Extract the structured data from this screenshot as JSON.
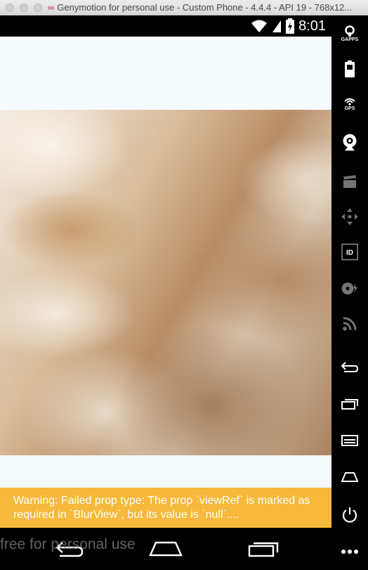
{
  "window": {
    "title": "Genymotion for personal use - Custom Phone - 4.4.4 - API 19 - 768x12..."
  },
  "statusbar": {
    "time": "8:01"
  },
  "app": {
    "warning_text": "Warning: Failed prop type: The prop `viewRef` is marked as required in `BlurView`, but its value is `null`...."
  },
  "watermark": "free for personal use",
  "sidebar": {
    "gapps_label": "GAPPS",
    "gps_label": "GPS",
    "id_label": "ID"
  },
  "colors": {
    "warning_bg": "#f6b93b",
    "app_bg": "#f5faff"
  }
}
